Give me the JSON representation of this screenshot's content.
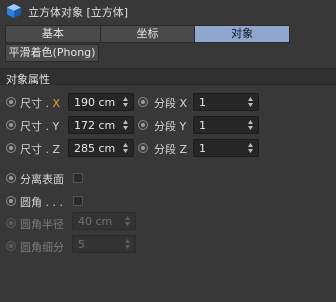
{
  "window": {
    "title": "立方体对象 [立方体]",
    "icon": "cube-icon"
  },
  "tabs": [
    {
      "label": "基本",
      "active": false
    },
    {
      "label": "坐标",
      "active": false
    },
    {
      "label": "对象",
      "active": true
    }
  ],
  "subtab": {
    "label": "平滑着色(Phong)"
  },
  "section": {
    "title": "对象属性"
  },
  "size_x": {
    "label": "尺寸 .",
    "axis": "X",
    "value": "190 cm"
  },
  "size_y": {
    "label": "尺寸 . Y",
    "value": "172 cm"
  },
  "size_z": {
    "label": "尺寸 . Z",
    "value": "285 cm"
  },
  "seg_x": {
    "label": "分段 X",
    "value": "1"
  },
  "seg_y": {
    "label": "分段 Y",
    "value": "1"
  },
  "seg_z": {
    "label": "分段 Z",
    "value": "1"
  },
  "separate_surfaces": {
    "label": "分离表面",
    "checked": false
  },
  "fillet": {
    "label": "圆角 . . .",
    "checked": false
  },
  "fillet_radius": {
    "label": "圆角半径",
    "value": "40 cm",
    "enabled": false
  },
  "fillet_subdiv": {
    "label": "圆角细分",
    "value": "5",
    "enabled": false
  },
  "colors": {
    "active_tab": "#8fa6cf",
    "axis_highlight": "#e0a040",
    "background": "#383838"
  }
}
